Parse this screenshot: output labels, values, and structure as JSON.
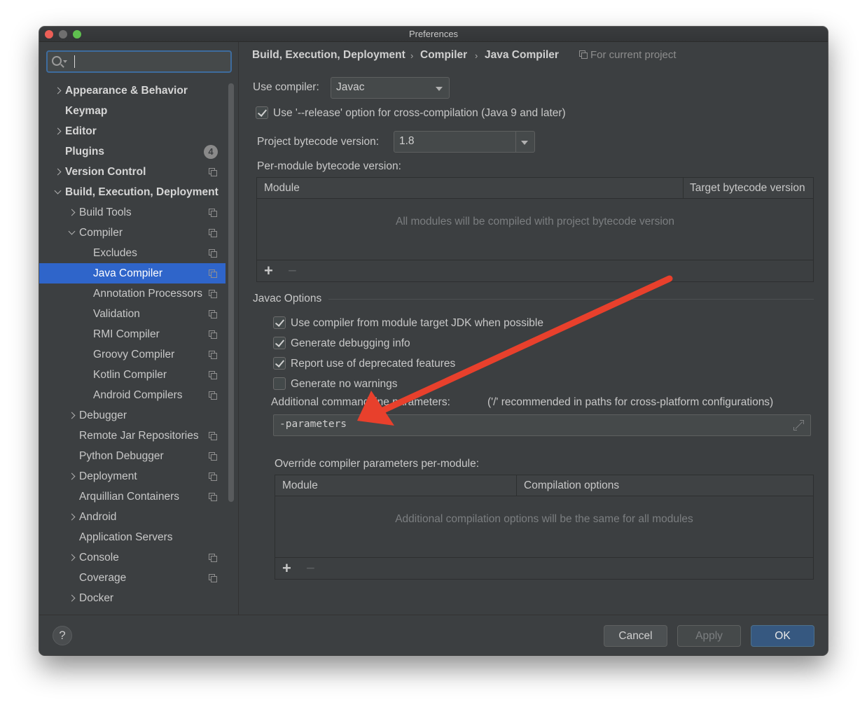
{
  "window": {
    "title": "Preferences"
  },
  "search": {
    "placeholder": ""
  },
  "sidebar": {
    "items": [
      {
        "label": "Appearance & Behavior",
        "bold": true,
        "chevron": "right",
        "level": 0
      },
      {
        "label": "Keymap",
        "bold": true,
        "chevron": "",
        "level": 0
      },
      {
        "label": "Editor",
        "bold": true,
        "chevron": "right",
        "level": 0
      },
      {
        "label": "Plugins",
        "bold": true,
        "chevron": "",
        "level": 0,
        "badge": "4"
      },
      {
        "label": "Version Control",
        "bold": true,
        "chevron": "right",
        "level": 0,
        "project": true
      },
      {
        "label": "Build, Execution, Deployment",
        "bold": true,
        "chevron": "down",
        "level": 0
      },
      {
        "label": "Build Tools",
        "chevron": "right",
        "level": 1,
        "project": true
      },
      {
        "label": "Compiler",
        "chevron": "down",
        "level": 1,
        "project": true
      },
      {
        "label": "Excludes",
        "chevron": "",
        "level": 2,
        "project": true
      },
      {
        "label": "Java Compiler",
        "chevron": "",
        "level": 2,
        "project": true,
        "selected": true
      },
      {
        "label": "Annotation Processors",
        "chevron": "",
        "level": 2,
        "project": true
      },
      {
        "label": "Validation",
        "chevron": "",
        "level": 2,
        "project": true
      },
      {
        "label": "RMI Compiler",
        "chevron": "",
        "level": 2,
        "project": true
      },
      {
        "label": "Groovy Compiler",
        "chevron": "",
        "level": 2,
        "project": true
      },
      {
        "label": "Kotlin Compiler",
        "chevron": "",
        "level": 2,
        "project": true
      },
      {
        "label": "Android Compilers",
        "chevron": "",
        "level": 2,
        "project": true
      },
      {
        "label": "Debugger",
        "chevron": "right",
        "level": 1
      },
      {
        "label": "Remote Jar Repositories",
        "chevron": "",
        "level": 1,
        "project": true
      },
      {
        "label": "Python Debugger",
        "chevron": "",
        "level": 1,
        "project": true
      },
      {
        "label": "Deployment",
        "chevron": "right",
        "level": 1,
        "project": true
      },
      {
        "label": "Arquillian Containers",
        "chevron": "",
        "level": 1,
        "project": true
      },
      {
        "label": "Android",
        "chevron": "right",
        "level": 1
      },
      {
        "label": "Application Servers",
        "chevron": "",
        "level": 1
      },
      {
        "label": "Console",
        "chevron": "right",
        "level": 1,
        "project": true
      },
      {
        "label": "Coverage",
        "chevron": "",
        "level": 1,
        "project": true
      },
      {
        "label": "Docker",
        "chevron": "right",
        "level": 1
      }
    ]
  },
  "breadcrumb": {
    "parts": [
      "Build, Execution, Deployment",
      "Compiler",
      "Java Compiler"
    ],
    "separator": "›",
    "scope": "For current project"
  },
  "compiler": {
    "use_compiler_label": "Use compiler:",
    "use_compiler_value": "Javac",
    "release_option_label": "Use '--release' option for cross-compilation (Java 9 and later)",
    "release_option_checked": true,
    "bytecode_label": "Project bytecode version:",
    "bytecode_value": "1.8",
    "per_module_label": "Per-module bytecode version:"
  },
  "module_table": {
    "columns": [
      "Module",
      "Target bytecode version"
    ],
    "empty_text": "All modules will be compiled with project bytecode version",
    "add": "+",
    "remove": "−"
  },
  "javac": {
    "section_title": "Javac Options",
    "options": [
      {
        "label": "Use compiler from module target JDK when possible",
        "checked": true
      },
      {
        "label": "Generate debugging info",
        "checked": true
      },
      {
        "label": "Report use of deprecated features",
        "checked": true
      },
      {
        "label": "Generate no warnings",
        "checked": false
      }
    ],
    "additional_label": "Additional command line parameters:",
    "additional_hint": "('/' recommended in paths for cross-platform configurations)",
    "additional_value": "-parameters",
    "override_label": "Override compiler parameters per-module:"
  },
  "override_table": {
    "columns": [
      "Module",
      "Compilation options"
    ],
    "empty_text": "Additional compilation options will be the same for all modules",
    "add": "+",
    "remove": "−"
  },
  "footer": {
    "help": "?",
    "cancel": "Cancel",
    "apply": "Apply",
    "ok": "OK"
  },
  "colors": {
    "background": "#3c3f41",
    "selection": "#2f65ca",
    "primary_button": "#365880",
    "annotation_arrow": "#e8402c"
  },
  "icons": [
    "search-icon",
    "chevron-right-icon",
    "chevron-down-icon",
    "project-scope-icon",
    "dropdown-arrow-icon",
    "checkbox-icon",
    "add-icon",
    "remove-icon",
    "expand-icon",
    "help-icon"
  ]
}
